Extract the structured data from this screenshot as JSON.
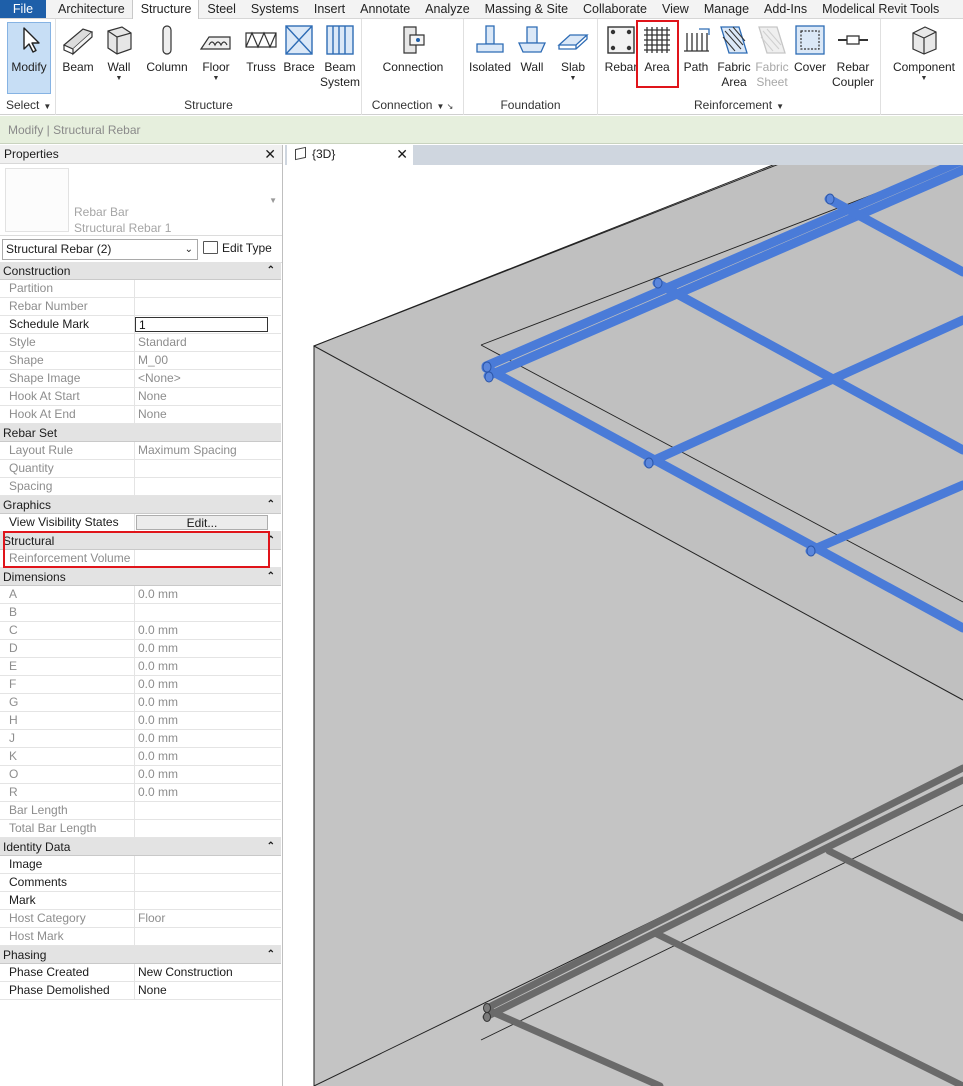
{
  "ribbon": {
    "tabs": [
      "File",
      "Architecture",
      "Structure",
      "Steel",
      "Systems",
      "Insert",
      "Annotate",
      "Analyze",
      "Massing & Site",
      "Collaborate",
      "View",
      "Manage",
      "Add-Ins",
      "Modelical Revit Tools"
    ],
    "active_tab": "Structure",
    "select": {
      "modify": "Modify",
      "title": "Select"
    },
    "structure": {
      "beam": "Beam",
      "wall": "Wall",
      "column": "Column",
      "floor": "Floor",
      "truss": "Truss",
      "brace": "Brace",
      "beam_system_1": "Beam",
      "beam_system_2": "System",
      "title": "Structure"
    },
    "connection": {
      "connection": "Connection",
      "title": "Connection"
    },
    "foundation": {
      "isolated": "Isolated",
      "wall": "Wall",
      "slab": "Slab",
      "title": "Foundation"
    },
    "reinforcement": {
      "rebar": "Rebar",
      "area": "Area",
      "path": "Path",
      "fabric_area_1": "Fabric",
      "fabric_area_2": "Area",
      "fabric_sheet_1": "Fabric",
      "fabric_sheet_2": "Sheet",
      "cover": "Cover",
      "rebar_coupler_1": "Rebar",
      "rebar_coupler_2": "Coupler",
      "title": "Reinforcement"
    },
    "component": {
      "label": "Component"
    }
  },
  "context_bar": "Modify | Structural Rebar",
  "properties": {
    "title": "Properties",
    "type_family": "Rebar Bar",
    "type_name": "Structural Rebar 1",
    "filter": "Structural Rebar (2)",
    "edit_type": "Edit Type",
    "groups": {
      "construction": {
        "label": "Construction",
        "partition": {
          "k": "Partition",
          "v": ""
        },
        "rebar_number": {
          "k": "Rebar Number",
          "v": ""
        },
        "schedule_mark": {
          "k": "Schedule Mark",
          "v": "1"
        },
        "style": {
          "k": "Style",
          "v": "Standard"
        },
        "shape": {
          "k": "Shape",
          "v": "M_00"
        },
        "shape_image": {
          "k": "Shape Image",
          "v": "<None>"
        },
        "hook_start": {
          "k": "Hook At Start",
          "v": "None"
        },
        "hook_end": {
          "k": "Hook At End",
          "v": "None"
        }
      },
      "rebar_set": {
        "label": "Rebar Set",
        "layout_rule": {
          "k": "Layout Rule",
          "v": "Maximum Spacing"
        },
        "quantity": {
          "k": "Quantity",
          "v": ""
        },
        "spacing": {
          "k": "Spacing",
          "v": ""
        }
      },
      "graphics": {
        "label": "Graphics",
        "vis_states": {
          "k": "View Visibility States",
          "v": "Edit..."
        }
      },
      "structural": {
        "label": "Structural",
        "reinf_volume": {
          "k": "Reinforcement Volume",
          "v": ""
        }
      },
      "dimensions": {
        "label": "Dimensions",
        "a": {
          "k": "A",
          "v": "0.0 mm"
        },
        "b": {
          "k": "B",
          "v": ""
        },
        "c": {
          "k": "C",
          "v": "0.0 mm"
        },
        "d": {
          "k": "D",
          "v": "0.0 mm"
        },
        "e": {
          "k": "E",
          "v": "0.0 mm"
        },
        "f": {
          "k": "F",
          "v": "0.0 mm"
        },
        "g": {
          "k": "G",
          "v": "0.0 mm"
        },
        "h": {
          "k": "H",
          "v": "0.0 mm"
        },
        "j": {
          "k": "J",
          "v": "0.0 mm"
        },
        "kk": {
          "k": "K",
          "v": "0.0 mm"
        },
        "o": {
          "k": "O",
          "v": "0.0 mm"
        },
        "r": {
          "k": "R",
          "v": "0.0 mm"
        },
        "bar_length": {
          "k": "Bar Length",
          "v": ""
        },
        "total_bar_length": {
          "k": "Total Bar Length",
          "v": ""
        }
      },
      "identity": {
        "label": "Identity Data",
        "image": {
          "k": "Image",
          "v": ""
        },
        "comments": {
          "k": "Comments",
          "v": ""
        },
        "mark": {
          "k": "Mark",
          "v": ""
        },
        "host_category": {
          "k": "Host Category",
          "v": "Floor"
        },
        "host_mark": {
          "k": "Host Mark",
          "v": ""
        }
      },
      "phasing": {
        "label": "Phasing",
        "phase_created": {
          "k": "Phase Created",
          "v": "New Construction"
        },
        "phase_demolished": {
          "k": "Phase Demolished",
          "v": "None"
        }
      }
    }
  },
  "view": {
    "tab_label": "{3D}"
  },
  "colors": {
    "file_tab": "#1e5fa9",
    "selected_rebar": "#4a7bd8",
    "highlight": "#e0141a",
    "concrete": "#c0c0c0",
    "unselected_rebar": "#6a6a6a",
    "context_bar": "#e6efdd"
  }
}
